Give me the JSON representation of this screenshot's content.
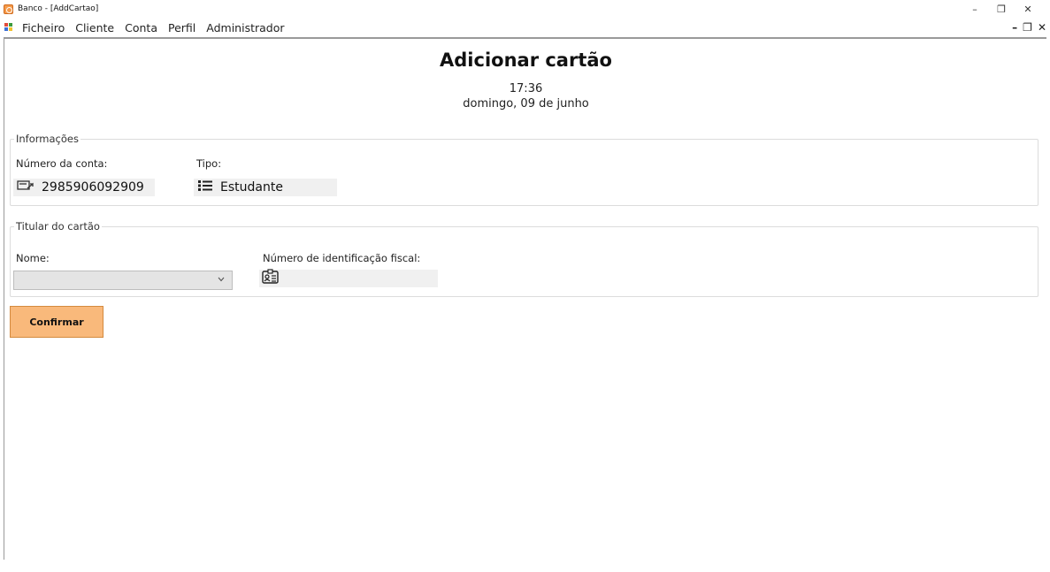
{
  "window": {
    "title": "Banco - [AddCartao]",
    "minimize_glyph": "–",
    "maximize_glyph": "❐",
    "close_glyph": "✕"
  },
  "menubar": {
    "items": [
      "Ficheiro",
      "Cliente",
      "Conta",
      "Perfil",
      "Administrador"
    ],
    "mdi_minimize": "–",
    "mdi_restore": "❐",
    "mdi_close": "✕"
  },
  "page": {
    "title": "Adicionar cartão",
    "time": "17:36",
    "date": "domingo, 09 de junho"
  },
  "informacoes": {
    "legend": "Informações",
    "account_label": "Número da conta:",
    "account_value": "2985906092909",
    "account_icon": "account-card-icon",
    "type_label": "Tipo:",
    "type_value": "Estudante",
    "type_icon": "list-icon"
  },
  "titular": {
    "legend": "Titular do cartão",
    "name_label": "Nome:",
    "name_value": "",
    "nif_label": "Número de identificação fiscal:",
    "nif_value": "",
    "nif_icon": "id-badge-icon"
  },
  "actions": {
    "confirm_label": "Confirmar"
  },
  "colors": {
    "accent": "#f9b97b",
    "accent_border": "#d48a3e",
    "field_bg": "#f0f0f0"
  }
}
